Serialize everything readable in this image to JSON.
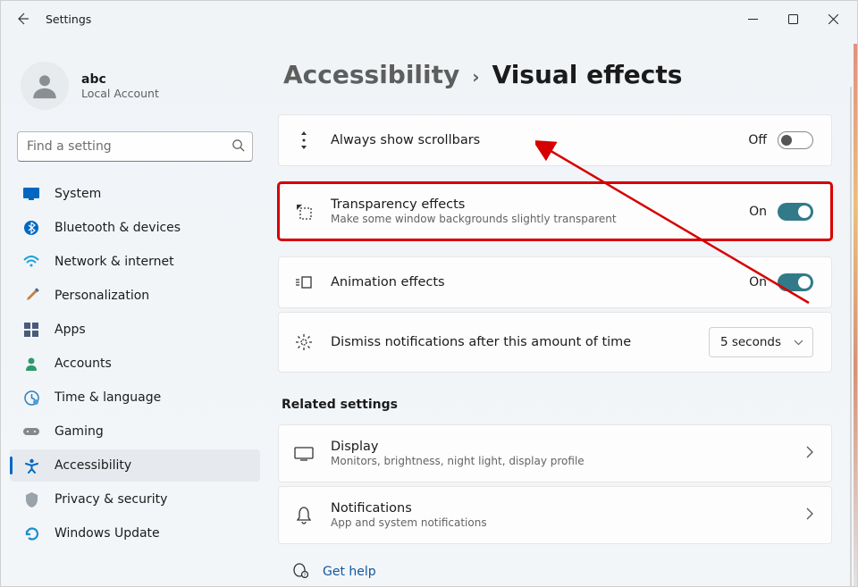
{
  "window": {
    "title": "Settings"
  },
  "profile": {
    "name": "abc",
    "sub": "Local Account"
  },
  "search": {
    "placeholder": "Find a setting"
  },
  "sidebar": {
    "items": [
      {
        "label": "System"
      },
      {
        "label": "Bluetooth & devices"
      },
      {
        "label": "Network & internet"
      },
      {
        "label": "Personalization"
      },
      {
        "label": "Apps"
      },
      {
        "label": "Accounts"
      },
      {
        "label": "Time & language"
      },
      {
        "label": "Gaming"
      },
      {
        "label": "Accessibility"
      },
      {
        "label": "Privacy & security"
      },
      {
        "label": "Windows Update"
      }
    ]
  },
  "breadcrumb": {
    "parent": "Accessibility",
    "sep": "›",
    "current": "Visual effects"
  },
  "settings": {
    "scrollbars": {
      "title": "Always show scrollbars",
      "state": "Off"
    },
    "transparency": {
      "title": "Transparency effects",
      "sub": "Make some window backgrounds slightly transparent",
      "state": "On"
    },
    "animation": {
      "title": "Animation effects",
      "state": "On"
    },
    "dismiss": {
      "title": "Dismiss notifications after this amount of time",
      "value": "5 seconds"
    }
  },
  "related": {
    "heading": "Related settings",
    "display": {
      "title": "Display",
      "sub": "Monitors, brightness, night light, display profile"
    },
    "notifications": {
      "title": "Notifications",
      "sub": "App and system notifications"
    }
  },
  "help": {
    "label": "Get help"
  }
}
